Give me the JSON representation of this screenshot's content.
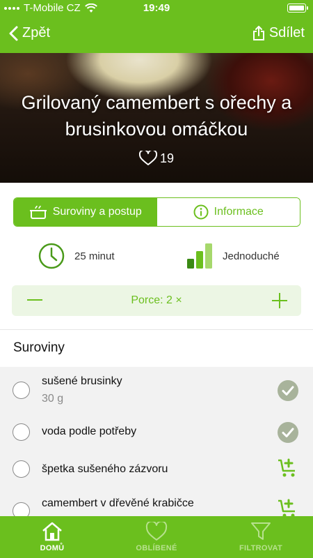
{
  "status_bar": {
    "carrier": "T-Mobile CZ",
    "time": "19:49"
  },
  "nav": {
    "back_label": "Zpět",
    "share_label": "Sdílet"
  },
  "recipe": {
    "title": "Grilovaný camembert s ořechy a brusinkovou omáčkou",
    "likes": "19"
  },
  "tabs_segment": {
    "ingredients_label": "Suroviny a postup",
    "info_label": "Informace"
  },
  "details": {
    "time": "25 minut",
    "difficulty": "Jednoduché"
  },
  "portions": {
    "label": "Porce: 2 ×"
  },
  "ingredients": {
    "title": "Suroviny",
    "items": [
      {
        "name": "sušené brusinky",
        "qty": "30 g",
        "status": "check-circle-icon"
      },
      {
        "name": "voda podle potřeby",
        "qty": "",
        "status": "check-circle-icon"
      },
      {
        "name": "špetka sušeného zázvoru",
        "qty": "",
        "status": "cart-plus-icon"
      },
      {
        "name": "camembert v dřevěné krabičce",
        "qty": "",
        "status": "cart-plus-icon"
      }
    ]
  },
  "tab_bar": {
    "items": [
      {
        "label": "DOMŮ",
        "icon": "home-icon",
        "active": true
      },
      {
        "label": "OBLÍBENÉ",
        "icon": "heart-icon",
        "active": false
      },
      {
        "label": "FILTROVAT",
        "icon": "filter-icon",
        "active": false
      }
    ]
  },
  "colors": {
    "accent": "#6bbf1e",
    "accent_light": "#ecf6e4",
    "check_gray": "#a8b39b"
  }
}
